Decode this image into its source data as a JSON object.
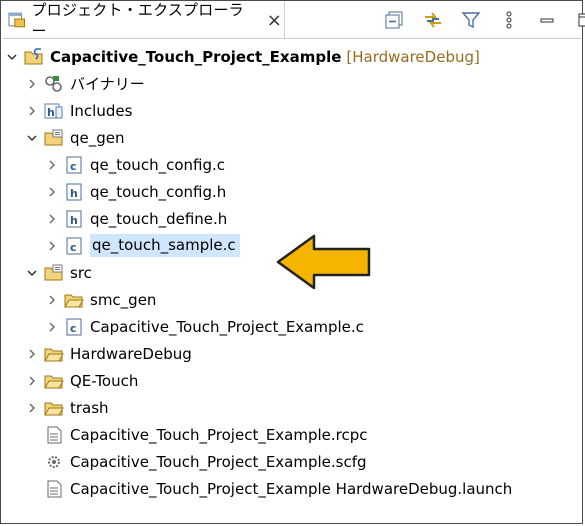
{
  "panel": {
    "title": "プロジェクト・エクスプローラー",
    "close_glyph": "×",
    "toolbar": [
      "collapse-all-icon",
      "link-editor-icon",
      "filter-icon",
      "view-menu-icon",
      "minimize-icon",
      "maximize-icon"
    ]
  },
  "tree": {
    "project": {
      "name": "Capacitive_Touch_Project_Example",
      "decoration": "[HardwareDebug]"
    },
    "binaries": "バイナリー",
    "includes": "Includes",
    "qe_gen": {
      "name": "qe_gen",
      "files": [
        "qe_touch_config.c",
        "qe_touch_config.h",
        "qe_touch_define.h",
        "qe_touch_sample.c"
      ]
    },
    "src": {
      "name": "src",
      "folder": "smc_gen",
      "file": "Capacitive_Touch_Project_Example.c"
    },
    "folders": [
      "HardwareDebug",
      "QE-Touch",
      "trash"
    ],
    "files": [
      "Capacitive_Touch_Project_Example.rcpc",
      "Capacitive_Touch_Project_Example.scfg",
      "Capacitive_Touch_Project_Example HardwareDebug.launch"
    ]
  },
  "colors": {
    "selection": "#cfe6fb",
    "arrow_fill": "#f5b400",
    "arrow_stroke": "#222222",
    "decoration": "#9a6b1e"
  }
}
